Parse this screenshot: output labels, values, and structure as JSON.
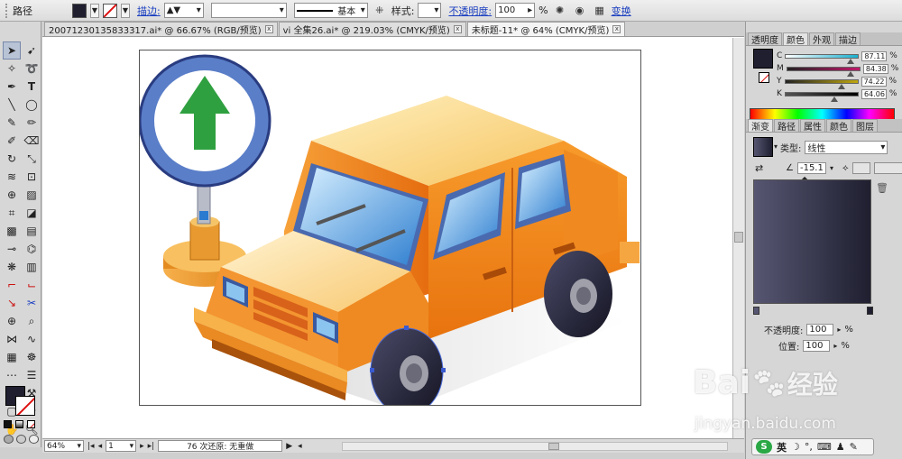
{
  "control_bar": {
    "object_type": "路径",
    "stroke_link": "描边:",
    "stroke_profile": "基本",
    "style_label": "样式:",
    "opacity_link": "不透明度:",
    "opacity_value": "100",
    "opacity_unit": "%",
    "transform_link": "变换"
  },
  "tabs": [
    {
      "label": "20071230135833317.ai* @ 66.67% (RGB/预览)"
    },
    {
      "label": "vi 全集26.ai* @ 219.03% (CMYK/预览)"
    },
    {
      "label": "未标题-11* @ 64% (CMYK/预览)"
    }
  ],
  "status_bar": {
    "zoom": "64%",
    "page": "1",
    "history": "76 次还原: 无重做"
  },
  "color_panel": {
    "tabs": [
      "透明度",
      "颜色",
      "外观",
      "描边"
    ],
    "active_tab": "颜色",
    "channels": [
      {
        "name": "C",
        "value": "87.11",
        "color": "#1ab0d0"
      },
      {
        "name": "M",
        "value": "84.38",
        "color": "#d01a7a"
      },
      {
        "name": "Y",
        "value": "74.22",
        "color": "#e6d010"
      },
      {
        "name": "K",
        "value": "64.06",
        "color": "#222222"
      }
    ],
    "percent_unit": "%",
    "current_color": "#1f1f30"
  },
  "gradient_panel": {
    "tabs": [
      "渐变",
      "路径",
      "属性",
      "颜色",
      "图层"
    ],
    "active_tab": "渐变",
    "type_label": "类型:",
    "type_value": "线性",
    "angle": "-15.1",
    "opacity_label": "不透明度:",
    "opacity_value": "100",
    "location_label": "位置:",
    "location_value": "100",
    "unit": "%",
    "gradient_start": "#565672",
    "gradient_end": "#1f1f30"
  },
  "ime": {
    "mode": "英"
  },
  "watermark": {
    "brand": "Bai",
    "brand_tail": "经验",
    "url": "jingyan.baidu.com"
  }
}
